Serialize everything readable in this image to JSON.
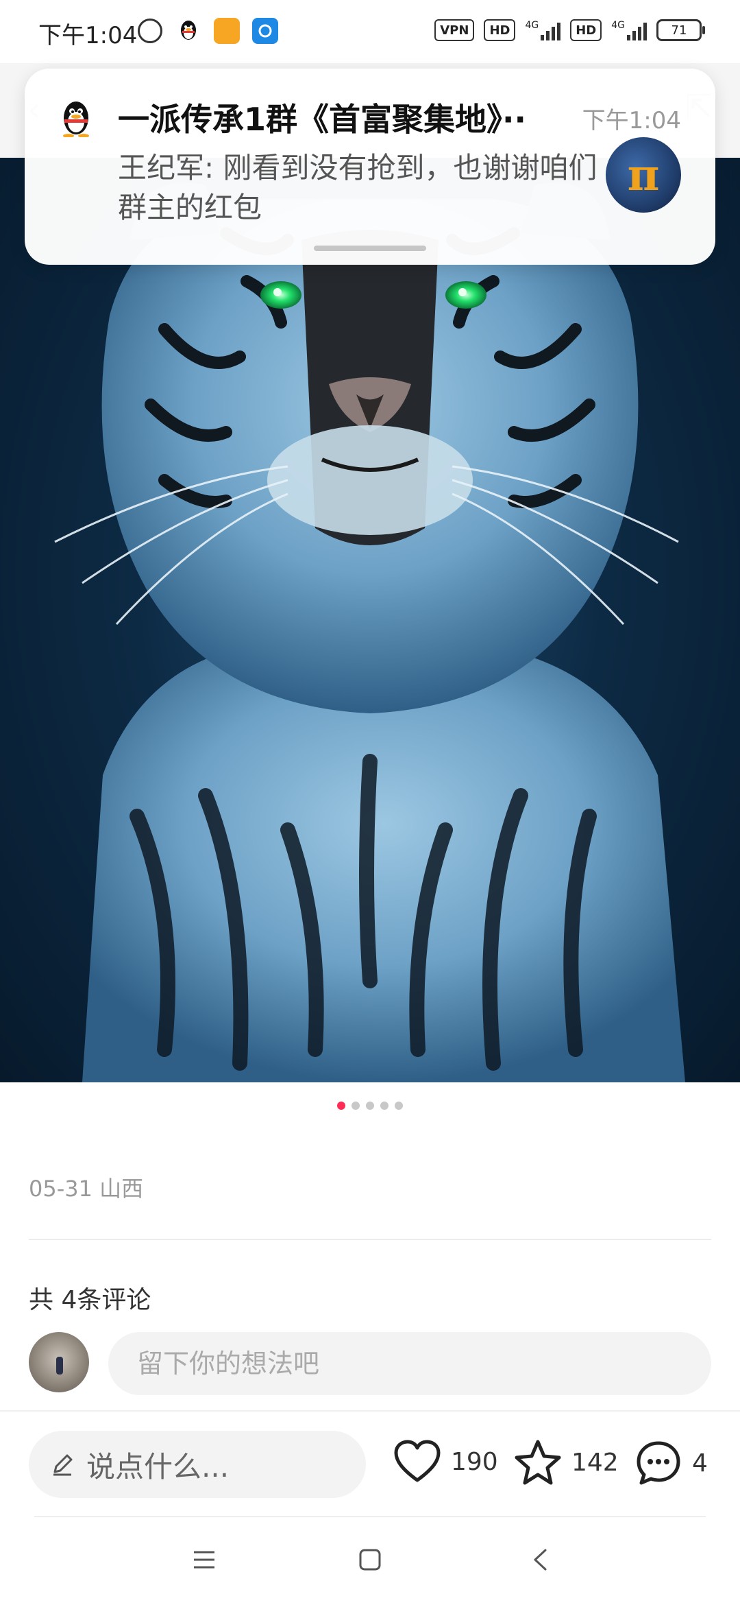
{
  "status_bar": {
    "time": "下午1:04",
    "vpn": "VPN",
    "hd1": "HD",
    "net1": "4G",
    "hd2": "HD",
    "net2": "4G",
    "battery": "71"
  },
  "header": {
    "title": "",
    "follow": ""
  },
  "notification": {
    "app_icon": "qq-penguin-icon",
    "title": "一派传承1群《首富聚集地》··",
    "time": "下午1:04",
    "body": "王纪军: 刚看到没有抢到，也谢谢咱们群主的红包"
  },
  "post": {
    "image_subject": "white-tiger",
    "pages": 5,
    "active_page": 1,
    "meta": "05-31 山西"
  },
  "comments": {
    "count_label": "共 4条评论",
    "placeholder": "留下你的想法吧"
  },
  "action_bar": {
    "say_placeholder": "说点什么...",
    "likes": "190",
    "favorites": "142",
    "comments": "4"
  },
  "colors": {
    "accent": "#ff2d55",
    "text": "#222222",
    "muted": "#999999"
  }
}
